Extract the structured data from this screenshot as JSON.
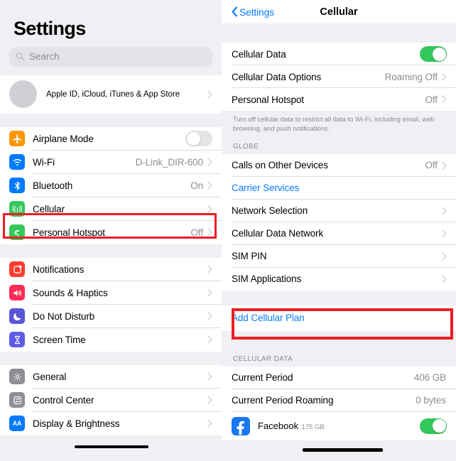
{
  "left": {
    "title": "Settings",
    "search": {
      "placeholder": "Search",
      "icon": "search-icon"
    },
    "account": {
      "label": "Apple ID, iCloud, iTunes & App Store",
      "avatar": "avatar-placeholder"
    },
    "groups": [
      {
        "items": [
          {
            "label": "Airplane Mode",
            "icon": "airplane-icon",
            "icon_color": "#FF9500",
            "control": "toggle",
            "toggle_on": false
          },
          {
            "label": "Wi-Fi",
            "icon": "wifi-icon",
            "icon_color": "#007AFF",
            "value": "D-Link_DIR-600",
            "control": "chevron"
          },
          {
            "label": "Bluetooth",
            "icon": "bluetooth-icon",
            "icon_color": "#007AFF",
            "value": "On",
            "control": "chevron"
          },
          {
            "label": "Cellular",
            "icon": "cellular-antenna-icon",
            "icon_color": "#34C759",
            "value": "",
            "control": "chevron",
            "highlighted": true
          },
          {
            "label": "Personal Hotspot",
            "icon": "hotspot-icon",
            "icon_color": "#34C759",
            "value": "Off",
            "control": "chevron"
          }
        ]
      },
      {
        "items": [
          {
            "label": "Notifications",
            "icon": "notifications-icon",
            "icon_color": "#FF3B30",
            "value": "",
            "control": "chevron"
          },
          {
            "label": "Sounds & Haptics",
            "icon": "sounds-icon",
            "icon_color": "#FF2D55",
            "value": "",
            "control": "chevron"
          },
          {
            "label": "Do Not Disturb",
            "icon": "moon-icon",
            "icon_color": "#5856D6",
            "value": "",
            "control": "chevron"
          },
          {
            "label": "Screen Time",
            "icon": "hourglass-icon",
            "icon_color": "#5E5CE6",
            "value": "",
            "control": "chevron"
          }
        ]
      },
      {
        "items": [
          {
            "label": "General",
            "icon": "gear-icon",
            "icon_color": "#8E8E93",
            "value": "",
            "control": "chevron"
          },
          {
            "label": "Control Center",
            "icon": "control-center-icon",
            "icon_color": "#8E8E93",
            "value": "",
            "control": "chevron"
          },
          {
            "label": "Display & Brightness",
            "icon": "display-brightness-icon",
            "icon_color": "#007AFF",
            "value": "",
            "control": "chevron",
            "redacted": true
          }
        ]
      }
    ]
  },
  "right": {
    "nav": {
      "back_label": "Settings",
      "title": "Cellular"
    },
    "group1": [
      {
        "label": "Cellular Data",
        "control": "toggle",
        "toggle_on": true
      },
      {
        "label": "Cellular Data Options",
        "value": "Roaming Off",
        "control": "chevron"
      },
      {
        "label": "Personal Hotspot",
        "value": "Off",
        "control": "chevron"
      }
    ],
    "footnote": "Turn off cellular data to restrict all data to Wi-Fi, including email, web browsing, and push notifications.",
    "section_globe": "GLOBE",
    "group2": [
      {
        "label": "Calls on Other Devices",
        "value": "Off",
        "control": "chevron"
      },
      {
        "label": "Carrier Services",
        "value": "",
        "control": "none",
        "link": true
      },
      {
        "label": "Network Selection",
        "value": "",
        "control": "chevron"
      },
      {
        "label": "Cellular Data Network",
        "value": "",
        "control": "chevron"
      },
      {
        "label": "SIM PIN",
        "value": "",
        "control": "chevron"
      },
      {
        "label": "SIM Applications",
        "value": "",
        "control": "chevron"
      }
    ],
    "add_plan": {
      "label": "Add Cellular Plan",
      "highlighted": true
    },
    "section_cellular_data": "CELLULAR DATA",
    "group3": [
      {
        "label": "Current Period",
        "value": "406 GB",
        "control": "none"
      },
      {
        "label": "Current Period Roaming",
        "value": "0 bytes",
        "control": "none"
      }
    ],
    "app": {
      "name": "Facebook",
      "size": "175 GB",
      "icon": "facebook-icon",
      "icon_color": "#1877F2",
      "toggle_on": true,
      "redacted": true
    }
  },
  "colors": {
    "accent_blue": "#0a7cff",
    "toggle_green": "#34c759",
    "highlight_red": "#ef1c23",
    "group_bg": "#efeff4"
  }
}
